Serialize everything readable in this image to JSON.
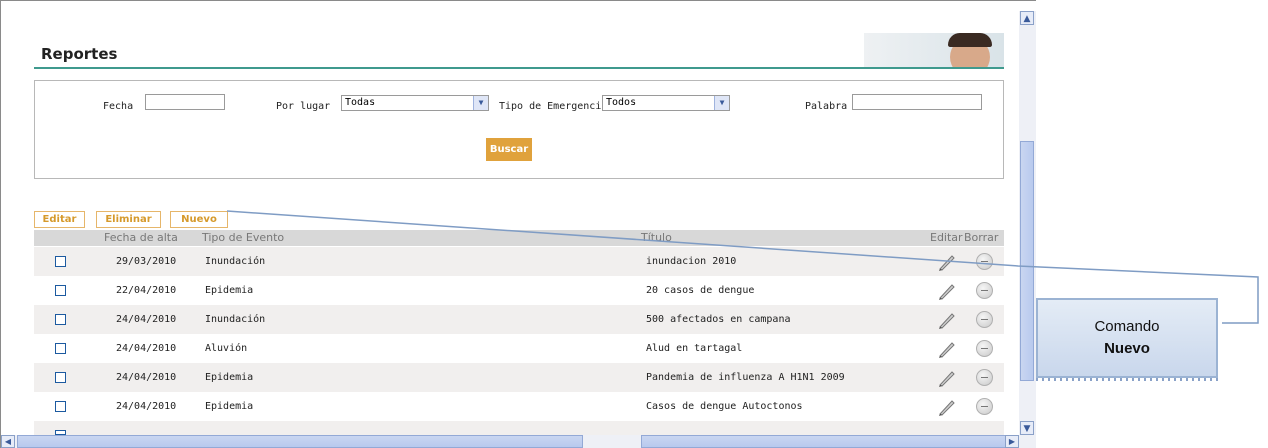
{
  "page": {
    "title": "Reportes"
  },
  "filters": {
    "fecha_label": "Fecha",
    "fecha_value": "",
    "lugar_label": "Por lugar",
    "lugar_value": "Todas",
    "tipo_label": "Tipo de Emergencia",
    "tipo_value": "Todos",
    "palabra_label": "Palabra",
    "palabra_value": "",
    "buscar_label": "Buscar"
  },
  "actions": {
    "editar": "Editar",
    "eliminar": "Eliminar",
    "nuevo": "Nuevo"
  },
  "table": {
    "headers": {
      "fecha": "Fecha de alta",
      "tipo": "Tipo de Evento",
      "titulo": "Título",
      "editar": "Editar",
      "borrar": "Borrar"
    },
    "rows": [
      {
        "fecha": "29/03/2010",
        "tipo": "Inundación",
        "titulo": "inundacion 2010"
      },
      {
        "fecha": "22/04/2010",
        "tipo": "Epidemia",
        "titulo": "20 casos de dengue"
      },
      {
        "fecha": "24/04/2010",
        "tipo": "Inundación",
        "titulo": "500 afectados en campana"
      },
      {
        "fecha": "24/04/2010",
        "tipo": "Aluvión",
        "titulo": "Alud en tartagal"
      },
      {
        "fecha": "24/04/2010",
        "tipo": "Epidemia",
        "titulo": "Pandemia de influenza A H1N1 2009"
      },
      {
        "fecha": "24/04/2010",
        "tipo": "Epidemia",
        "titulo": "Casos de dengue Autoctonos"
      }
    ]
  },
  "callout": {
    "line1": "Comando",
    "line2": "Nuevo"
  },
  "colors": {
    "accent": "#e0a23c",
    "rule": "#3f9a8e",
    "callout_line": "#7f9cc4"
  }
}
